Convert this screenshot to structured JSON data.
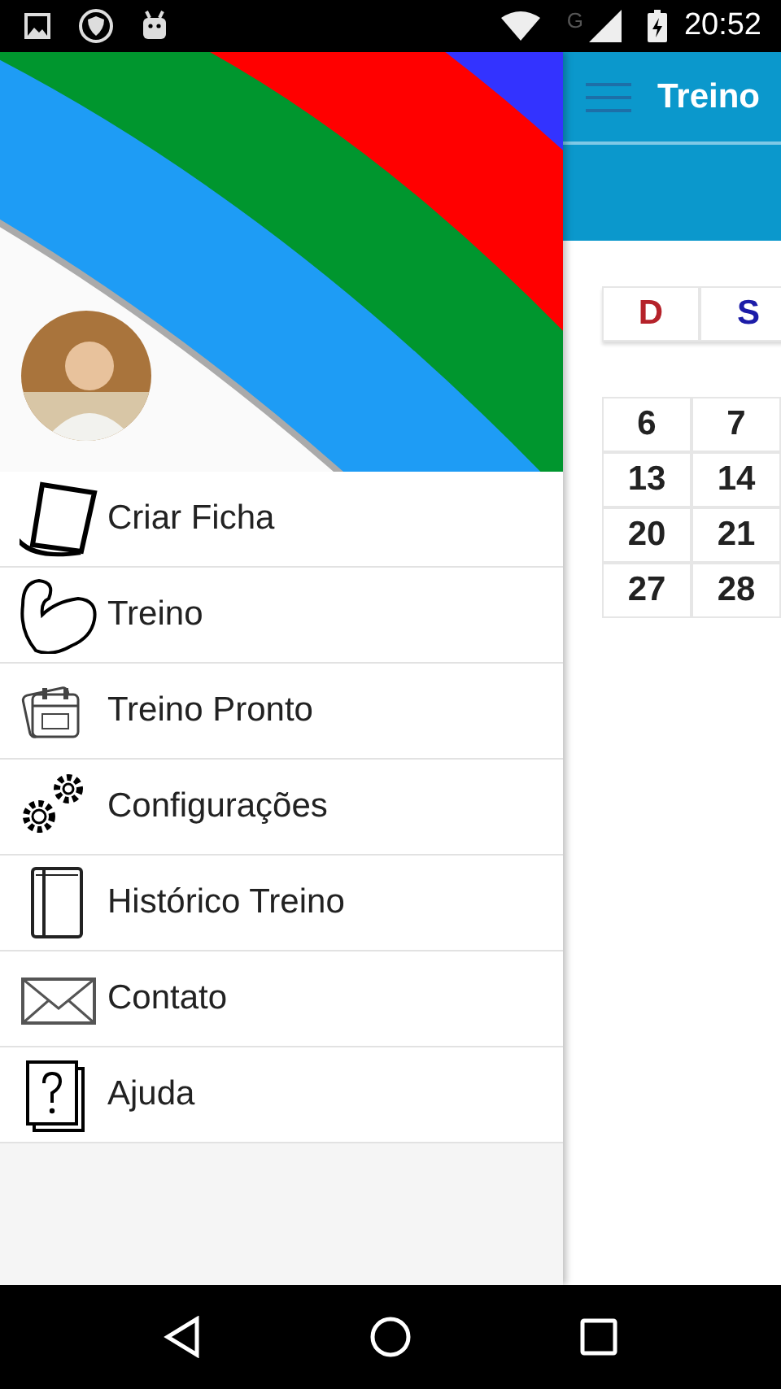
{
  "status_bar": {
    "network": "G",
    "time": "20:52"
  },
  "app_bar": {
    "title": "Treino"
  },
  "calendar": {
    "weekdays": [
      {
        "label": "D",
        "color": "#b5222a"
      },
      {
        "label": "S",
        "color": "#1c1ca8"
      }
    ],
    "weeks": [
      [
        "6",
        "7"
      ],
      [
        "13",
        "14"
      ],
      [
        "20",
        "21"
      ],
      [
        "27",
        "28"
      ]
    ]
  },
  "drawer": {
    "items": [
      {
        "kind": "sheet",
        "label": "Criar Ficha"
      },
      {
        "kind": "arm",
        "label": "Treino"
      },
      {
        "kind": "calendar",
        "label": "Treino Pronto"
      },
      {
        "kind": "gears",
        "label": "Configurações"
      },
      {
        "kind": "book",
        "label": "Histórico Treino"
      },
      {
        "kind": "envelope",
        "label": "Contato"
      },
      {
        "kind": "help",
        "label": "Ajuda"
      }
    ]
  }
}
